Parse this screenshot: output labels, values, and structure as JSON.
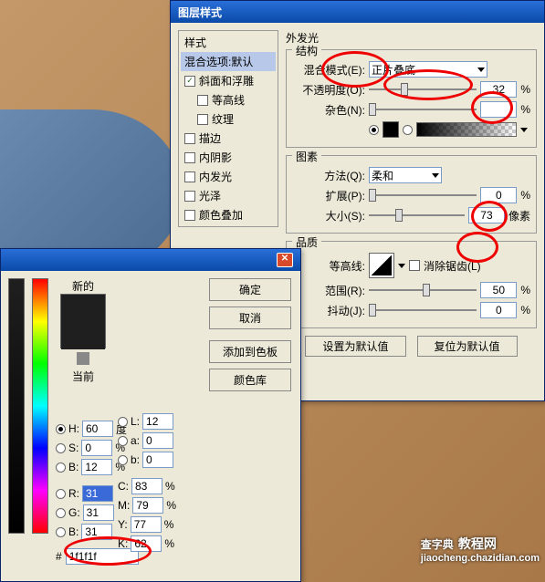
{
  "bg": {
    "watermark_main": "查字典",
    "watermark_sub": "jiaocheng.chazidian.com",
    "watermark_tag": "教程网"
  },
  "layerStyle": {
    "title": "图层样式",
    "stylesLabel": "样式",
    "blendOptionsLabel": "混合选项:默认",
    "items": [
      {
        "label": "斜面和浮雕",
        "checked": true
      },
      {
        "label": "等高线",
        "checked": false
      },
      {
        "label": "纹理",
        "checked": false
      },
      {
        "label": "描边",
        "checked": false
      },
      {
        "label": "内阴影",
        "checked": false
      },
      {
        "label": "内发光",
        "checked": false
      },
      {
        "label": "光泽",
        "checked": false
      },
      {
        "label": "颜色叠加",
        "checked": false
      }
    ],
    "outerGlow": {
      "title": "外发光",
      "structure": {
        "title": "结构",
        "blendModeLabel": "混合模式(E):",
        "blendModeValue": "正片叠底",
        "opacityLabel": "不透明度(O):",
        "opacityValue": "32",
        "noiseLabel": "杂色(N):",
        "noiseValue": ""
      },
      "elements": {
        "title": "图素",
        "methodLabel": "方法(Q):",
        "methodValue": "柔和",
        "spreadLabel": "扩展(P):",
        "spreadValue": "0",
        "sizeLabel": "大小(S):",
        "sizeValue": "73",
        "sizeUnit": "像素"
      },
      "quality": {
        "title": "品质",
        "contourLabel": "等高线:",
        "antiAliasLabel": "消除锯齿(L)",
        "rangeLabel": "范围(R):",
        "rangeValue": "50",
        "jitterLabel": "抖动(J):",
        "jitterValue": "0"
      },
      "pct": "%",
      "defaultBtn": "设置为默认值",
      "resetBtn": "复位为默认值"
    }
  },
  "colorPicker": {
    "newLabel": "新的",
    "currentLabel": "当前",
    "okBtn": "确定",
    "cancelBtn": "取消",
    "addBtn": "添加到色板",
    "libBtn": "颜色库",
    "H": {
      "label": "H:",
      "value": "60",
      "unit": "度"
    },
    "S": {
      "label": "S:",
      "value": "0",
      "unit": "%"
    },
    "Bv": {
      "label": "B:",
      "value": "12",
      "unit": "%"
    },
    "R": {
      "label": "R:",
      "value": "31"
    },
    "G": {
      "label": "G:",
      "value": "31"
    },
    "B": {
      "label": "B:",
      "value": "31"
    },
    "L": {
      "label": "L:",
      "value": "12"
    },
    "a": {
      "label": "a:",
      "value": "0"
    },
    "b": {
      "label": "b:",
      "value": "0"
    },
    "C": {
      "label": "C:",
      "value": "83",
      "unit": "%"
    },
    "M": {
      "label": "M:",
      "value": "79",
      "unit": "%"
    },
    "Y": {
      "label": "Y:",
      "value": "77",
      "unit": "%"
    },
    "K": {
      "label": "K:",
      "value": "62",
      "unit": "%"
    },
    "hexLabel": "#",
    "hexValue": "1f1f1f"
  }
}
